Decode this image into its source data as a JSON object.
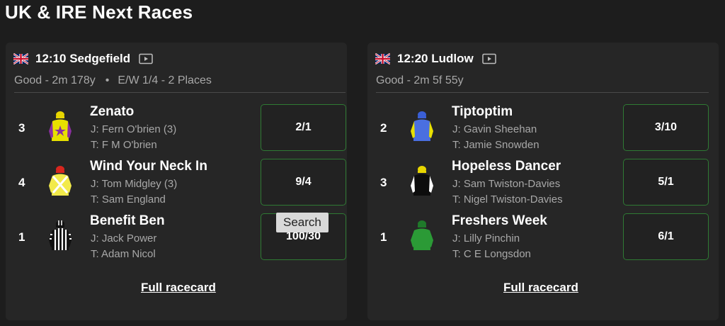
{
  "page": {
    "title": "UK & IRE Next Races"
  },
  "races": [
    {
      "title": "12:10 Sedgefield",
      "going": "Good - 2m 178y",
      "separator": "•",
      "ew": "E/W 1/4 - 2 Places",
      "runners": [
        {
          "number": "3",
          "name": "Zenato",
          "jockey": "J: Fern O'brien (3)",
          "trainer": "T: F M O'brien",
          "odds": "2/1"
        },
        {
          "number": "4",
          "name": "Wind Your Neck In",
          "jockey": "J: Tom Midgley (3)",
          "trainer": "T: Sam England",
          "odds": "9/4"
        },
        {
          "number": "1",
          "name": "Benefit Ben",
          "jockey": "J: Jack Power",
          "trainer": "T: Adam Nicol",
          "odds": "100/30"
        }
      ],
      "full_racecard": "Full racecard"
    },
    {
      "title": "12:20 Ludlow",
      "going": "Good - 2m 5f 55y",
      "runners": [
        {
          "number": "2",
          "name": "Tiptoptim",
          "jockey": "J: Gavin Sheehan",
          "trainer": "T: Jamie Snowden",
          "odds": "3/10"
        },
        {
          "number": "3",
          "name": "Hopeless Dancer",
          "jockey": "J: Sam Twiston-Davies",
          "trainer": "T: Nigel Twiston-Davies",
          "odds": "5/1"
        },
        {
          "number": "1",
          "name": "Freshers Week",
          "jockey": "J: Lilly Pinchin",
          "trainer": "T: C E Longsdon",
          "odds": "6/1"
        }
      ],
      "full_racecard": "Full racecard"
    }
  ],
  "tooltip": {
    "text": "Search"
  },
  "colors": {
    "background": "#1d1d1d",
    "card": "#262626",
    "odds_border": "#2f7a34",
    "muted_text": "#a8a8a8"
  }
}
